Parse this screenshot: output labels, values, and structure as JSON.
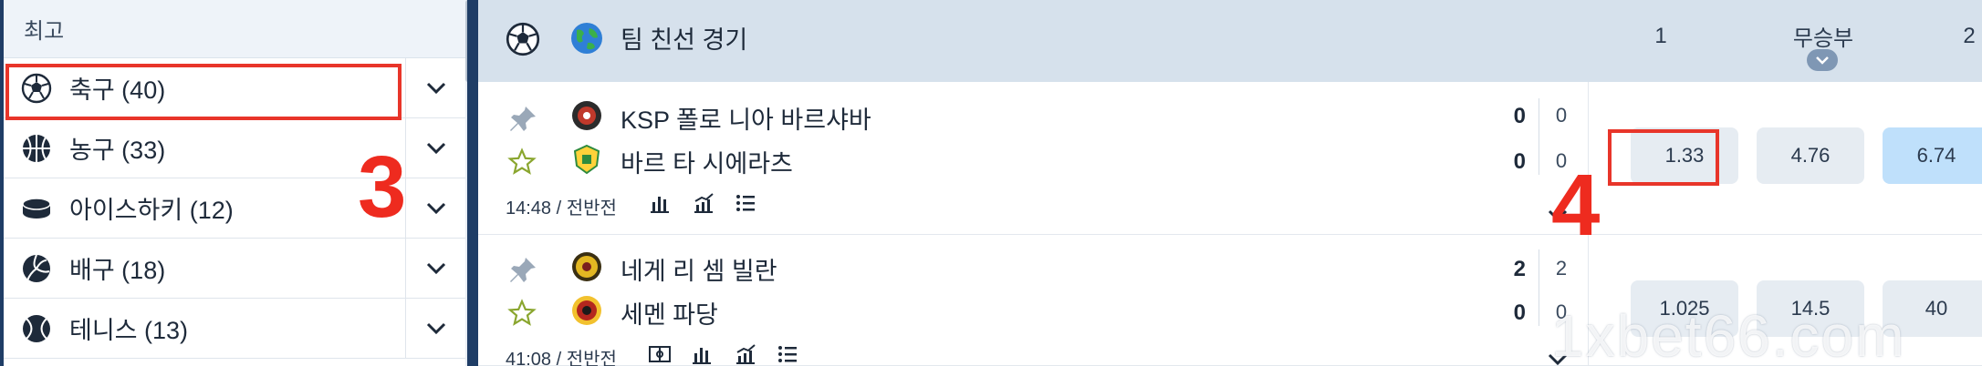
{
  "sidebar": {
    "header": "최고",
    "items": [
      {
        "label": "축구 (40)",
        "icon": "soccer-ball-icon"
      },
      {
        "label": "농구 (33)",
        "icon": "basketball-icon"
      },
      {
        "label": "아이스하키 (12)",
        "icon": "hockey-puck-icon"
      },
      {
        "label": "배구 (18)",
        "icon": "volleyball-icon"
      },
      {
        "label": "테니스 (13)",
        "icon": "tennis-ball-icon"
      }
    ]
  },
  "annotations": {
    "step_left": "3",
    "step_right": "4"
  },
  "main": {
    "header": {
      "title": "팀 친선 경기",
      "col_1": "1",
      "col_draw": "무승부",
      "col_2": "2"
    },
    "matches": [
      {
        "team1": "KSP 폴로 니아 바르샤바",
        "team2": "바르 타 시에라츠",
        "score1": "0",
        "score2": "0",
        "period1": "0",
        "period2": "0",
        "time": "14:48 / 전반전",
        "odds": [
          "1.33",
          "4.76",
          "6.74"
        ]
      },
      {
        "team1": "네게 리 셈 빌란",
        "team2": "세멘 파당",
        "score1": "2",
        "score2": "0",
        "period1": "2",
        "period2": "0",
        "time": "41:08 / 전반전",
        "odds": [
          "1.025",
          "14.5",
          "40"
        ]
      }
    ]
  },
  "watermark": "1xbet66.com",
  "colors": {
    "accent_navy": "#1f3d66",
    "header_bg": "#d6e1ec",
    "highlight_red": "#e8352a",
    "odd_up": "#bfe0fb"
  }
}
